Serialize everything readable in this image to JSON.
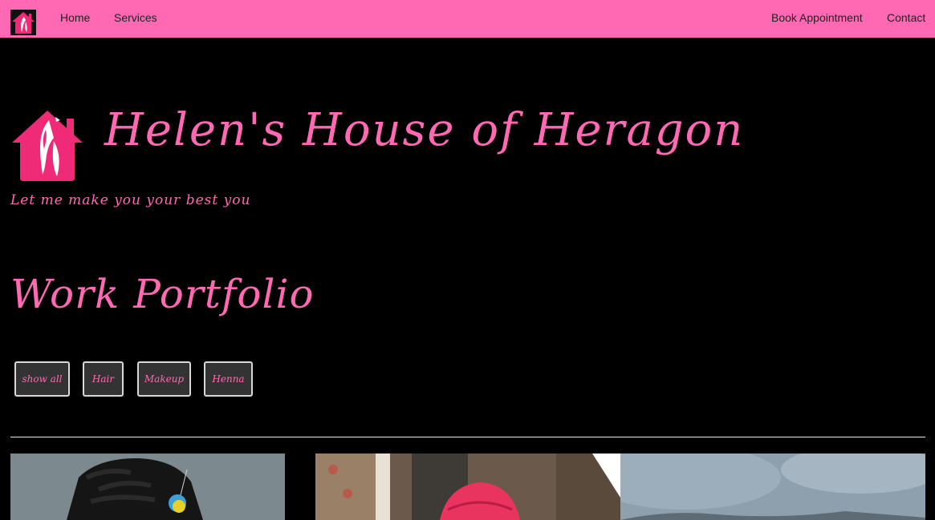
{
  "nav": {
    "home": "Home",
    "services": "Services",
    "book_appointment": "Book Appointment",
    "contact": "Contact"
  },
  "hero": {
    "title": "Helen's House of Heragon",
    "tagline": "Let me make you your best you"
  },
  "portfolio": {
    "heading": "Work Portfolio",
    "filters": [
      "show all",
      "Hair",
      "Makeup",
      "Henna"
    ]
  },
  "colors": {
    "brand_pink": "#ff69b4",
    "background": "#000000",
    "logo_pink": "#ef2a77"
  }
}
